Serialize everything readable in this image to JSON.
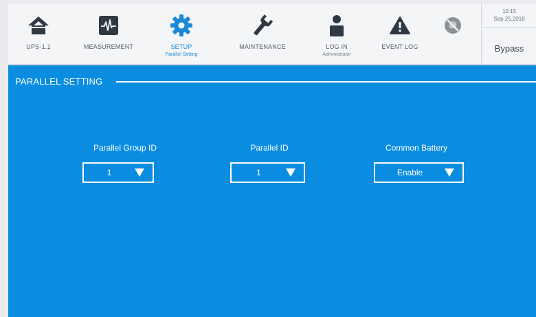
{
  "nav": {
    "items": [
      {
        "id": "ups",
        "label": "UPS-1.1",
        "sub": ""
      },
      {
        "id": "measurement",
        "label": "MEASUREMENT",
        "sub": ""
      },
      {
        "id": "setup",
        "label": "SETUP",
        "sub": "Parallel Setting"
      },
      {
        "id": "maintenance",
        "label": "MAINTENANCE",
        "sub": ""
      },
      {
        "id": "login",
        "label": "LOG IN",
        "sub": "Administrator"
      },
      {
        "id": "eventlog",
        "label": "EVENT LOG",
        "sub": ""
      }
    ],
    "active": "setup",
    "mute_icon": "mute-disabled-icon"
  },
  "status": {
    "time": "10:15",
    "date": "Sep 25,2018",
    "mode": "Bypass"
  },
  "section": {
    "title": "PARALLEL SETTING"
  },
  "fields": [
    {
      "label": "Parallel Group ID",
      "value": "1"
    },
    {
      "label": "Parallel ID",
      "value": "1"
    },
    {
      "label": "Common Battery",
      "value": "Enable"
    }
  ],
  "colors": {
    "accent": "#1b8ad6",
    "background": "#0a8de0",
    "topbar": "#f4f5f7",
    "icon": "#2f3944"
  }
}
